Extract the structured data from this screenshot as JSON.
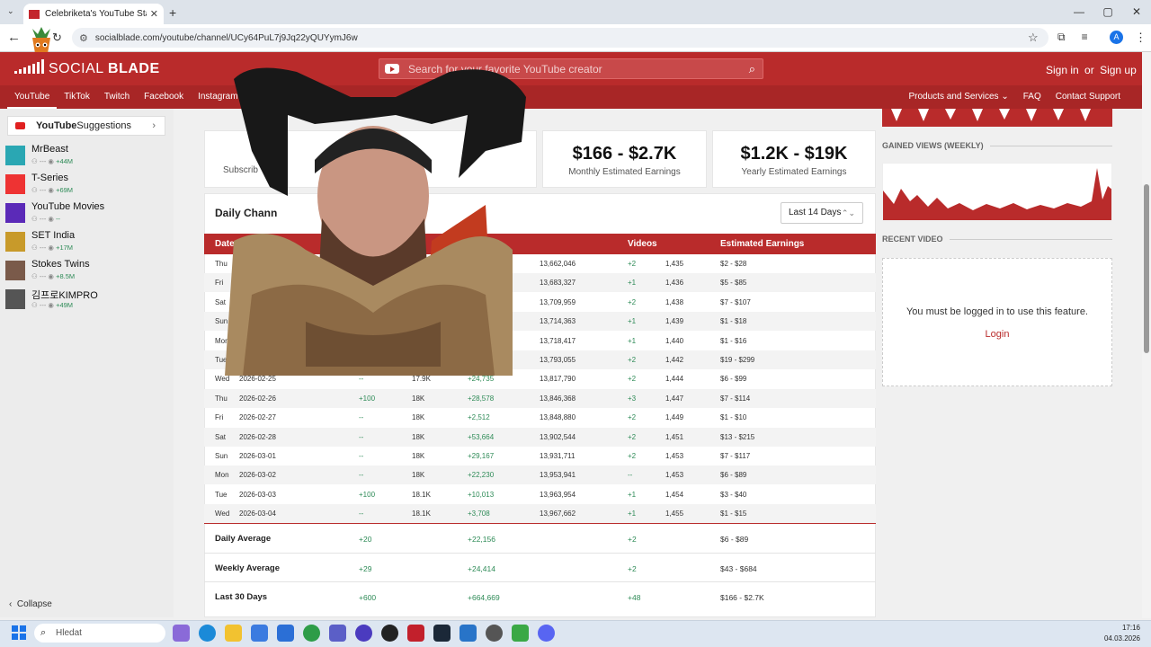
{
  "browser": {
    "tab_title": "Celebriketa's YouTube Statistic",
    "tab_close": "✕",
    "new_tab": "+",
    "url": "socialblade.com/youtube/channel/UCy64PuL7j9Jq22yQUYymJ6w",
    "window_controls": [
      "—",
      "▢",
      "✕"
    ],
    "profile_initial": "A"
  },
  "header": {
    "brand_first": "SOCIAL",
    "brand_second": "BLADE",
    "search_placeholder": "Search for your favorite YouTube creator",
    "sign_in": "Sign in",
    "or": "or",
    "sign_up": "Sign up"
  },
  "nav": {
    "items": [
      "YouTube",
      "TikTok",
      "Twitch",
      "Facebook",
      "Instagram"
    ],
    "right": [
      "Products and Services",
      "FAQ",
      "Contact Support"
    ]
  },
  "sidebar": {
    "suggestions_title_bold": "YouTube",
    "suggestions_title_rest": " Suggestions",
    "channels": [
      {
        "name": "MrBeast",
        "dash": "---",
        "gain": "+44M",
        "color": "#2aa7b3"
      },
      {
        "name": "T-Series",
        "dash": "---",
        "gain": "+69M",
        "color": "#e33"
      },
      {
        "name": "YouTube Movies",
        "dash": "---",
        "gain": "--",
        "color": "#5b2ab8"
      },
      {
        "name": "SET India",
        "dash": "---",
        "gain": "+17M",
        "color": "#c89a2a"
      },
      {
        "name": "Stokes Twins",
        "dash": "---",
        "gain": "+8.5M",
        "color": "#7a5a4a"
      },
      {
        "name": "김프로KIMPRO",
        "dash": "---",
        "gain": "+49M",
        "color": "#555"
      }
    ],
    "collapse": "Collapse"
  },
  "stats": {
    "monthly_value": "$166 - $2.7K",
    "monthly_label": "Monthly Estimated Earnings",
    "yearly_value": "$1.2K - $19K",
    "yearly_label": "Yearly Estimated Earnings",
    "subscribers_label_partial": "Subscrib"
  },
  "table": {
    "title_partial": "Daily Chann",
    "range": "Last 14 Days",
    "headers": {
      "date": "Date",
      "videos": "Videos",
      "earnings": "Estimated Earnings"
    },
    "rows": [
      {
        "day": "Thu",
        "date": "2026-02-1",
        "sd": "",
        "subs": "",
        "vd": "",
        "views": "13,662,046",
        "vidd": "+2",
        "videos": "1,435",
        "earn": "$2 - $28"
      },
      {
        "day": "Fri",
        "date": "2026-02",
        "sd": "",
        "subs": "",
        "vd": "",
        "views": "13,683,327",
        "vidd": "+1",
        "videos": "1,436",
        "earn": "$5 - $85"
      },
      {
        "day": "Sat",
        "date": "2026-0",
        "sd": "",
        "subs": "",
        "vd": "632",
        "views": "13,709,959",
        "vidd": "+2",
        "videos": "1,438",
        "earn": "$7 - $107"
      },
      {
        "day": "Sun",
        "date": "2026-",
        "sd": "",
        "subs": "",
        "vd": "404",
        "views": "13,714,363",
        "vidd": "+1",
        "videos": "1,439",
        "earn": "$1 - $18"
      },
      {
        "day": "Mon",
        "date": "2026",
        "sd": "",
        "subs": "",
        "vd": "054",
        "views": "13,718,417",
        "vidd": "+1",
        "videos": "1,440",
        "earn": "$1 - $16"
      },
      {
        "day": "Tue",
        "date": "",
        "sd": "",
        "subs": "",
        "vd": "",
        "views": "13,793,055",
        "vidd": "+2",
        "videos": "1,442",
        "earn": "$19 - $299"
      },
      {
        "day": "Wed",
        "date": "2026-02-25",
        "sd": "--",
        "subs": "17.9K",
        "vd": "+24,735",
        "views": "13,817,790",
        "vidd": "+2",
        "videos": "1,444",
        "earn": "$6 - $99"
      },
      {
        "day": "Thu",
        "date": "2026-02-26",
        "sd": "+100",
        "subs": "18K",
        "vd": "+28,578",
        "views": "13,846,368",
        "vidd": "+3",
        "videos": "1,447",
        "earn": "$7 - $114"
      },
      {
        "day": "Fri",
        "date": "2026-02-27",
        "sd": "--",
        "subs": "18K",
        "vd": "+2,512",
        "views": "13,848,880",
        "vidd": "+2",
        "videos": "1,449",
        "earn": "$1 - $10"
      },
      {
        "day": "Sat",
        "date": "2026-02-28",
        "sd": "--",
        "subs": "18K",
        "vd": "+53,664",
        "views": "13,902,544",
        "vidd": "+2",
        "videos": "1,451",
        "earn": "$13 - $215"
      },
      {
        "day": "Sun",
        "date": "2026-03-01",
        "sd": "--",
        "subs": "18K",
        "vd": "+29,167",
        "views": "13,931,711",
        "vidd": "+2",
        "videos": "1,453",
        "earn": "$7 - $117"
      },
      {
        "day": "Mon",
        "date": "2026-03-02",
        "sd": "--",
        "subs": "18K",
        "vd": "+22,230",
        "views": "13,953,941",
        "vidd": "--",
        "videos": "1,453",
        "earn": "$6 - $89"
      },
      {
        "day": "Tue",
        "date": "2026-03-03",
        "sd": "+100",
        "subs": "18.1K",
        "vd": "+10,013",
        "views": "13,963,954",
        "vidd": "+1",
        "videos": "1,454",
        "earn": "$3 - $40"
      },
      {
        "day": "Wed",
        "date": "2026-03-04",
        "sd": "--",
        "subs": "18.1K",
        "vd": "+3,708",
        "views": "13,967,662",
        "vidd": "+1",
        "videos": "1,455",
        "earn": "$1 - $15"
      }
    ],
    "summary": [
      {
        "label": "Daily Average",
        "subs": "+20",
        "views": "+22,156",
        "videos": "+2",
        "earn": "$6 - $89"
      },
      {
        "label": "Weekly Average",
        "subs": "+29",
        "views": "+24,414",
        "videos": "+2",
        "earn": "$43 - $684"
      },
      {
        "label": "Last 30 Days",
        "subs": "+600",
        "views": "+664,669",
        "videos": "+48",
        "earn": "$166 - $2.7K"
      }
    ]
  },
  "right": {
    "gained_views": "GAINED VIEWS (WEEKLY)",
    "recent_video": "RECENT VIDEO",
    "login_message": "You must be logged in to use this feature.",
    "login": "Login"
  },
  "taskbar": {
    "search": "Hledat",
    "time": "17:16",
    "date": "04.03.2026"
  }
}
